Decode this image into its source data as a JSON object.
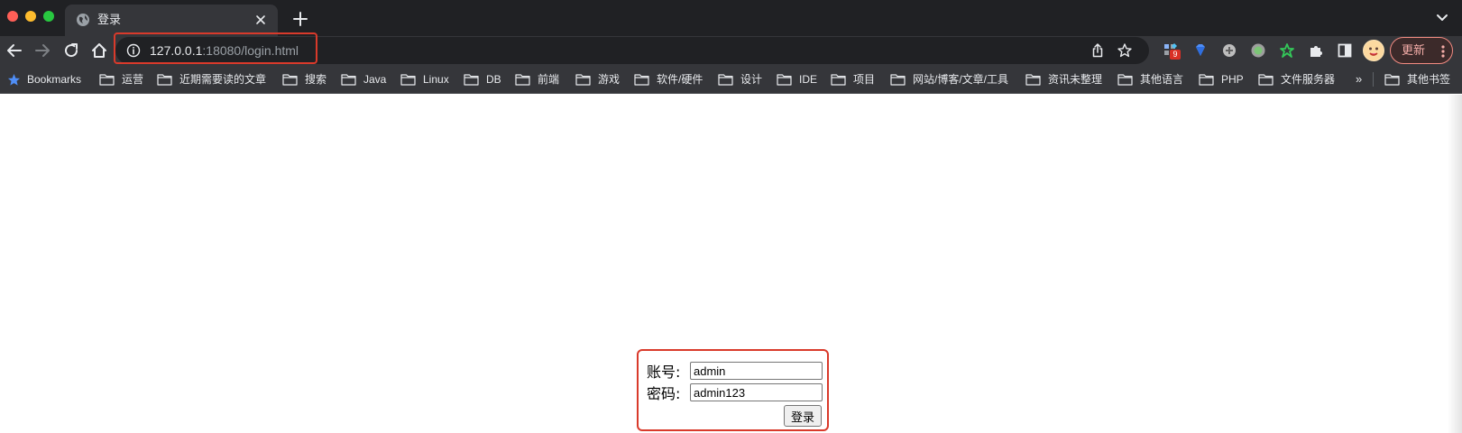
{
  "tab": {
    "title": "登录"
  },
  "address_bar": {
    "host": "127.0.0.1",
    "rest": ":18080/login.html"
  },
  "extensions": {
    "badge_count": "9"
  },
  "update_button": {
    "label": "更新"
  },
  "bookmarks": {
    "items": [
      "Bookmarks",
      "运营",
      "近期需要读的文章",
      "搜索",
      "Java",
      "Linux",
      "DB",
      "前端",
      "游戏",
      "软件/硬件",
      "设计",
      "IDE",
      "项目",
      "网站/博客/文章/工具",
      "资讯未整理",
      "其他语言",
      "PHP",
      "文件服务器"
    ],
    "overflow": "»",
    "other": "其他书签"
  },
  "login_form": {
    "account_label": "账号:",
    "account_value": "admin",
    "password_label": "密码:",
    "password_value": "admin123",
    "submit_label": "登录"
  },
  "colors": {
    "highlight": "#d93a2b",
    "chrome_dark": "#202124",
    "toolbar": "#35363a"
  }
}
